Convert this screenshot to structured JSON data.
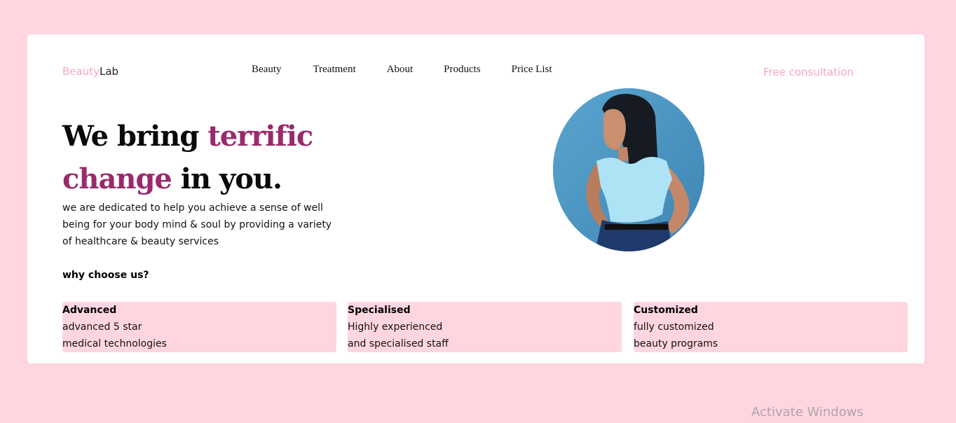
{
  "brand": {
    "part1": "Beauty",
    "part2": "Lab"
  },
  "nav": {
    "items": [
      "Beauty",
      "Treatment",
      "About",
      "Products",
      "Price List"
    ]
  },
  "cta": {
    "label": "Free consultation"
  },
  "hero": {
    "line1_plain": "We bring ",
    "line1_accent": "terrific",
    "line2_accent": "change",
    "line2_plain": " in you.",
    "description": "we are dedicated to help you achieve a sense of well being for your body mind & soul by providing a variety of healthcare & beauty services",
    "why_heading": "why choose us?"
  },
  "features": [
    {
      "title": "Advanced",
      "line1": "advanced 5 star",
      "line2": "medical technologies"
    },
    {
      "title": "Specialised",
      "line1": "Highly experienced",
      "line2": "and specialised staff"
    },
    {
      "title": "Customized",
      "line1": "fully customized",
      "line2": "beauty programs"
    }
  ],
  "watermark": "Activate Windows",
  "colors": {
    "background": "#ffd5e0",
    "accent": "#992a6b",
    "brand_pink": "#f4a7c0",
    "feature_bg": "#ffd5e0"
  },
  "icons": {
    "photo": "woman-portrait-image"
  }
}
